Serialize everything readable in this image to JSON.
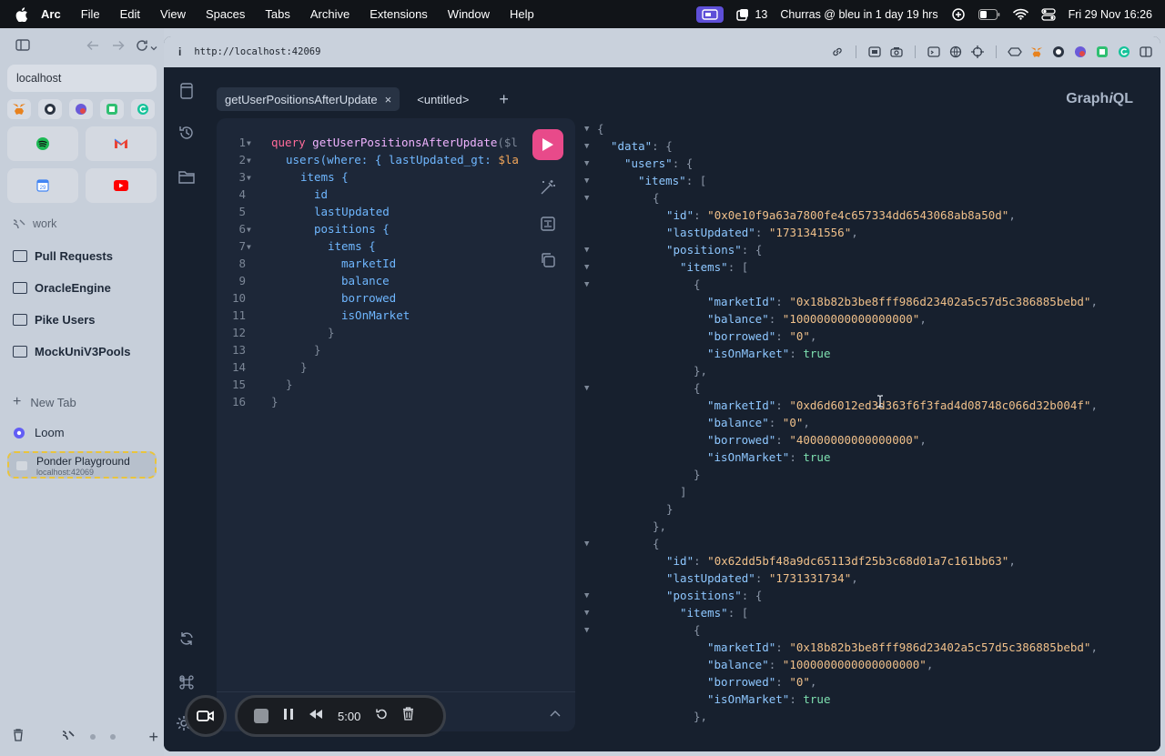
{
  "menubar": {
    "app": "Arc",
    "items": [
      "File",
      "Edit",
      "View",
      "Spaces",
      "Tabs",
      "Archive",
      "Extensions",
      "Window",
      "Help"
    ],
    "notifications_count": "13",
    "calendar_event": "Churras @ bleu in 1 day 19 hrs",
    "datetime": "Fri 29 Nov  16:26"
  },
  "sidebar": {
    "url_field": "localhost",
    "section_label": "work",
    "pinned": [
      {
        "label": "Pull Requests"
      },
      {
        "label": "OracleEngine"
      },
      {
        "label": "Pike Users"
      },
      {
        "label": "MockUniV3Pools"
      }
    ],
    "new_tab_label": "New Tab",
    "loom_label": "Loom",
    "active_tab": {
      "title": "Ponder Playground",
      "subtitle": "localhost:42069"
    }
  },
  "browser": {
    "url": "http://localhost:42069"
  },
  "graphiql": {
    "brand_prefix": "Graph",
    "brand_italic": "i",
    "brand_suffix": "QL",
    "tabs": [
      {
        "label": "getUserPositionsAfterUpdate",
        "active": true,
        "close": "×"
      },
      {
        "label": "<untitled>",
        "active": false
      }
    ],
    "add_tab": "+",
    "query_lines": [
      {
        "n": "1",
        "fold": true
      },
      {
        "n": "2",
        "fold": true
      },
      {
        "n": "3",
        "fold": true
      },
      {
        "n": "4"
      },
      {
        "n": "5"
      },
      {
        "n": "6",
        "fold": true
      },
      {
        "n": "7",
        "fold": true
      },
      {
        "n": "8"
      },
      {
        "n": "9"
      },
      {
        "n": "10"
      },
      {
        "n": "11"
      },
      {
        "n": "12"
      },
      {
        "n": "13"
      },
      {
        "n": "14"
      },
      {
        "n": "15"
      },
      {
        "n": "16"
      }
    ],
    "query_tokens": {
      "l1_kw": "query",
      "l1_name": "getUserPositionsAfterUpdate",
      "l1_rest": "($l",
      "l2_field": "users",
      "l2_mid": "(where: { lastUpdated_gt: ",
      "l2_var": "$la",
      "l3": "items {",
      "l4": "id",
      "l5": "lastUpdated",
      "l6": "positions {",
      "l7": "items {",
      "l8": "marketId",
      "l9": "balance",
      "l10": "borrowed",
      "l11": "isOnMarket",
      "close": "}"
    },
    "result": {
      "k_data": "\"data\"",
      "k_users": "\"users\"",
      "k_items": "\"items\"",
      "k_id": "\"id\"",
      "k_lastUpdated": "\"lastUpdated\"",
      "k_positions": "\"positions\"",
      "k_marketId": "\"marketId\"",
      "k_balance": "\"balance\"",
      "k_borrowed": "\"borrowed\"",
      "k_isOnMarket": "\"isOnMarket\"",
      "user1_id": "\"0x0e10f9a63a7800fe4c657334dd6543068ab8a50d\"",
      "user1_lastUpdated": "\"1731341556\"",
      "u1p1_marketId": "\"0x18b82b3be8fff986d23402a5c57d5c386885bebd\"",
      "u1p1_balance": "\"100000000000000000\"",
      "u1p1_borrowed": "\"0\"",
      "u1p1_isOnMarket": "true",
      "u1p2_marketId": "\"0xd6d6012ed3d363f6f3fad4d08748c066d32b004f\"",
      "u1p2_balance": "\"0\"",
      "u1p2_borrowed": "\"40000000000000000\"",
      "u1p2_isOnMarket": "true",
      "user2_id": "\"0x62dd5bf48a9dc65113df25b3c68d01a7c161bb63\"",
      "user2_lastUpdated": "\"1731331734\"",
      "u2p1_marketId": "\"0x18b82b3be8fff986d23402a5c57d5c386885bebd\"",
      "u2p1_balance": "\"1000000000000000000\"",
      "u2p1_borrowed": "\"0\"",
      "u2p1_isOnMarket": "true"
    }
  },
  "recorder": {
    "time": "5:00"
  },
  "colors": {
    "accent_run": "#e84a8a",
    "editor_bg": "#1d2738",
    "app_bg": "#17202e"
  }
}
